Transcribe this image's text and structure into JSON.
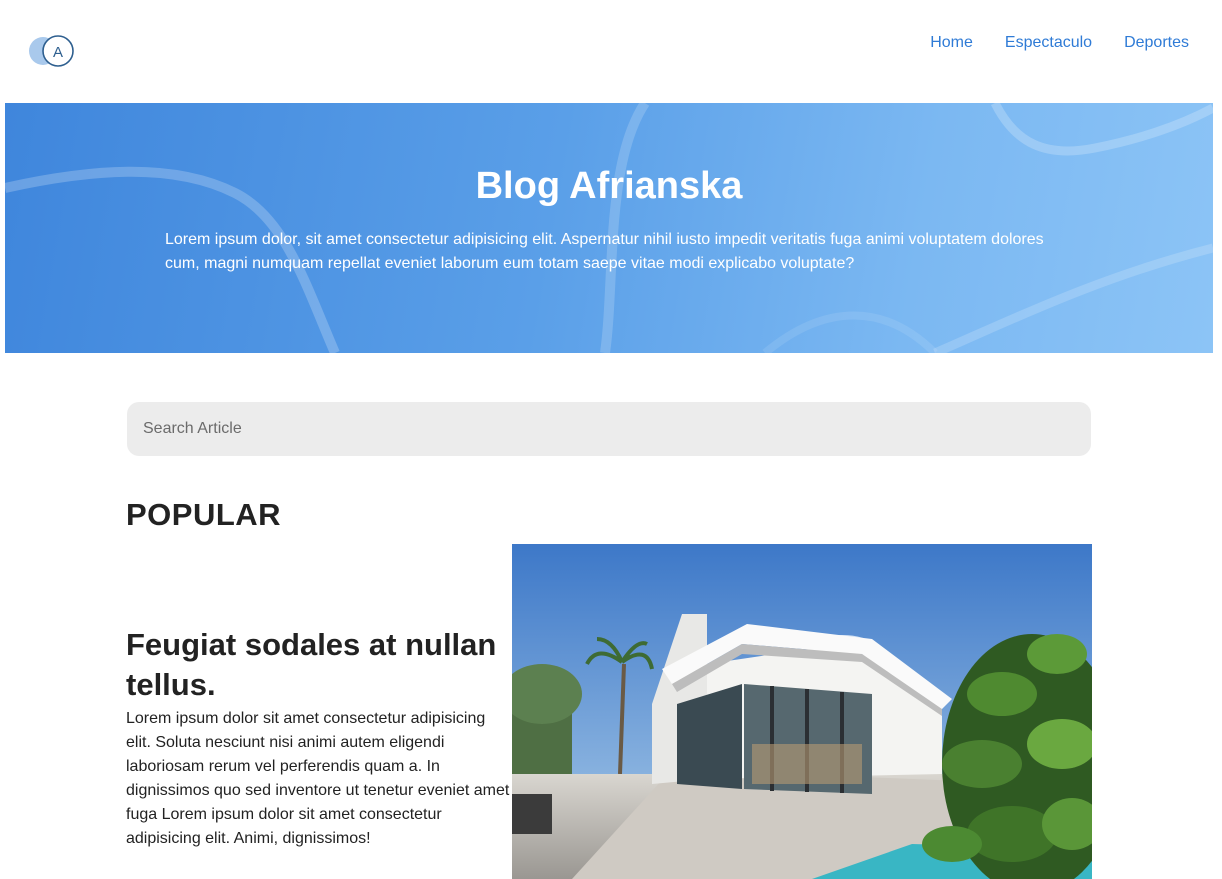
{
  "navbar": {
    "logo_letter": "A",
    "links": [
      {
        "label": "Home"
      },
      {
        "label": "Espectaculo"
      },
      {
        "label": "Deportes"
      }
    ]
  },
  "hero": {
    "title": "Blog Afrianska",
    "text": "Lorem ipsum dolor, sit amet consectetur adipisicing elit. Aspernatur nihil iusto impedit veritatis fuga animi voluptatem dolores cum, magni numquam repellat eveniet laborum eum totam saepe vitae modi explicabo voluptate?"
  },
  "search": {
    "placeholder": "Search Article",
    "value": ""
  },
  "popular": {
    "heading": "POPULAR",
    "article": {
      "title": "Feugiat sodales at nullan tellus.",
      "text": "Lorem ipsum dolor sit amet consectetur adipisicing elit. Soluta nesciunt nisi animi autem eligendi laboriosam rerum vel perferendis quam a. In dignissimos quo sed inventore ut tenetur eveniet amet fuga Lorem ipsum dolor sit amet consectetur adipisicing elit. Animi, dignissimos!",
      "image": "modern-house-photo"
    }
  },
  "colors": {
    "accent": "#2f7bd6",
    "hero_start": "#3f86dc",
    "hero_end": "#8cc4f6",
    "search_bg": "#ececec"
  }
}
